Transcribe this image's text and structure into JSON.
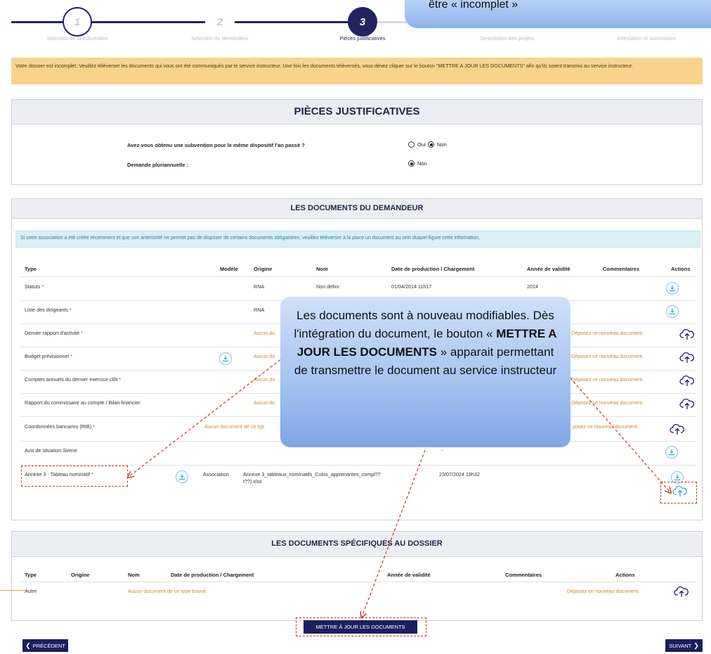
{
  "stepper": {
    "steps": [
      {
        "number": "1",
        "label": "Sélection de la subvention"
      },
      {
        "number": "2",
        "label": "Sélection du demandeur"
      },
      {
        "number": "3",
        "label": "Pièces justificatives"
      },
      {
        "number": "",
        "label": "Description des projets"
      },
      {
        "number": "",
        "label": "Attestation et soumission"
      }
    ]
  },
  "top_callout": "être « incomplet »",
  "alert": "Votre dossier est incomplet. Veuillez téléverser les documents qui vous ont été communiqués par le service instructeur. Une fois les documents téléversés, vous devez cliquer sur le bouton \"METTRE A JOUR LES DOCUMENTS\" afin qu'ils soient transmis au service instructeur.",
  "pieces": {
    "title": "PIÈCES JUSTIFICATIVES",
    "q1": "Avez-vous obtenu une subvention pour le même dispositif l'an passé ?",
    "q1_oui": "Oui",
    "q1_non": "Non",
    "q2": "Demande pluriannuelle :",
    "q2_non": "Non"
  },
  "demandeur": {
    "title": "LES DOCUMENTS DU DEMANDEUR",
    "info": "Si votre association a été créée récemment et que son antériorité ne permet pas de disposer de certains documents obligatoires, veuillez téléverser à la place un document au sein duquel figure cette information.",
    "headers": {
      "type": "Type",
      "modele": "Modèle",
      "origine": "Origine",
      "nom": "Nom",
      "date": "Date de production / Chargement",
      "annee": "Année de validité",
      "commentaires": "Commentaires",
      "actions": "Actions"
    },
    "rows": [
      {
        "type": "Statuts",
        "req": "*",
        "origine": "RNA",
        "nom": "Non défini",
        "date": "01/04/2014 11h17",
        "annee": "2014",
        "comment": ""
      },
      {
        "type": "Liste des dirigeants",
        "req": "*",
        "origine": "RNA",
        "nom": "",
        "date": "",
        "annee": "",
        "comment": ""
      },
      {
        "type": "Dernier rapport d'activité",
        "req": "*",
        "origine": "Aucun do",
        "nom": "",
        "date": "",
        "annee": "",
        "comment": "Déposez ce nouveau document."
      },
      {
        "type": "Budget prévisionnel",
        "req": "*",
        "origine": "Aucun do",
        "nom": "",
        "date": "",
        "annee": "",
        "comment": "Déposez ce nouveau document."
      },
      {
        "type": "Comptes annuels du dernier exercice clôt",
        "req": "*",
        "origine": "Aucun do",
        "nom": "",
        "date": "",
        "annee": "",
        "comment": "Déposez ce nouveau document."
      },
      {
        "type": "Rapport du commissaire au compte / Bilan financier",
        "req": "",
        "origine": "Aucun do",
        "nom": "",
        "date": "",
        "annee": "",
        "comment": "Déposez ce nouveau document."
      },
      {
        "type": "Coordonnées bancaires (RIB)",
        "req": "*",
        "origine": "Aucun document de ce typ",
        "nom": "",
        "date": "",
        "annee": "",
        "comment": "posez ce nouveau document."
      },
      {
        "type": "Avis de situation Sirene",
        "req": "",
        "origine": "",
        "nom": "",
        "date": "-",
        "annee": "",
        "comment": ""
      },
      {
        "type": "Annexe 3 - Tableau nominatif",
        "req": "*",
        "origine": "Association",
        "nom": "Annexe 3_tableaux_nominatifs_Colos_apprenantes_compl??",
        "nom2": "t??).xlsx",
        "date": "23/07/2024 19h32",
        "annee": "",
        "comment": ""
      }
    ]
  },
  "callout": {
    "text_a": "Les documents sont à nouveau modifiables. Dès l'intégration du document, le bouton « ",
    "text_bold": "METTRE A JOUR LES DOCUMENTS",
    "text_b": " » apparait permettant de transmettre le document au service instructeur"
  },
  "specifiques": {
    "title": "LES DOCUMENTS SPÉCIFIQUES AU DOSSIER",
    "headers": {
      "type": "Type",
      "origine": "Origine",
      "nom": "Nom",
      "date": "Date de production / Chargement",
      "annee": "Année de validité",
      "commentaires": "Commentaires",
      "actions": "Actions"
    },
    "row": {
      "type": "Autre",
      "nom": "Aucun document de ce type trouvé.",
      "comment": "Déposez ce nouveau document."
    }
  },
  "buttons": {
    "update": "METTRE À JOUR LES DOCUMENTS",
    "prev": "PRÉCÉDENT",
    "next": "SUIVANT"
  }
}
